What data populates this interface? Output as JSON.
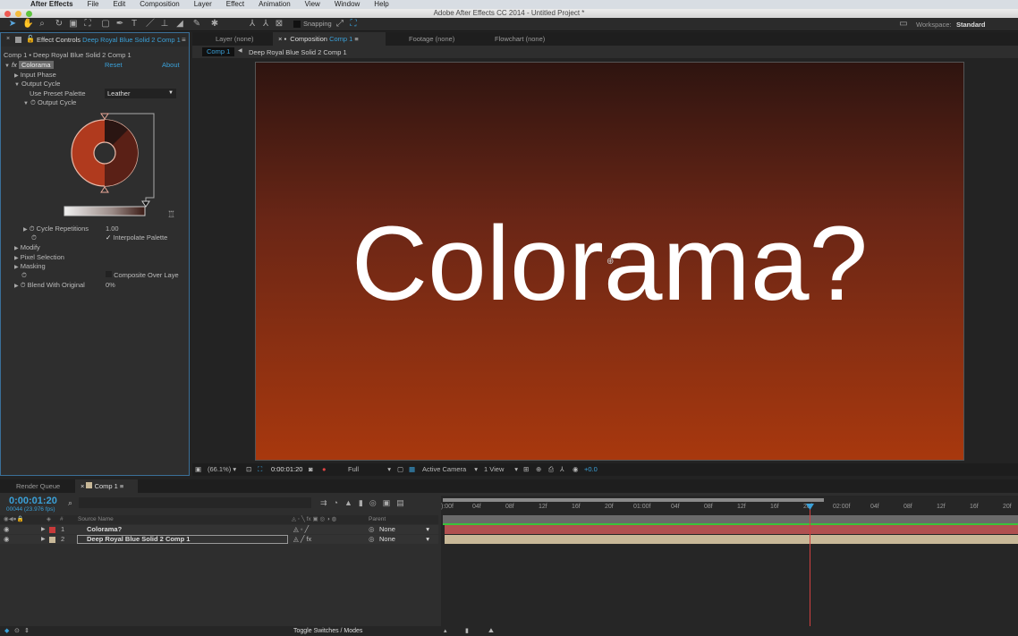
{
  "menubar": {
    "items": [
      "After Effects",
      "File",
      "Edit",
      "Composition",
      "Layer",
      "Effect",
      "Animation",
      "View",
      "Window",
      "Help"
    ]
  },
  "titlebar": {
    "title": "Adobe After Effects CC 2014 - Untitled Project *"
  },
  "toolbar": {
    "snapping_label": "Snapping",
    "workspace_label": "Workspace:",
    "workspace_value": "Standard"
  },
  "effect_controls": {
    "tab_label": "Effect Controls",
    "tab_layer": "Deep Royal Blue Solid 2 Comp 1",
    "breadcrumb": "Comp 1 • Deep Royal Blue Solid 2 Comp 1",
    "effect_name": "Colorama",
    "reset": "Reset",
    "about": "About",
    "props": {
      "input_phase": "Input Phase",
      "output_cycle": "Output Cycle",
      "use_preset_palette": "Use Preset Palette",
      "preset_value": "Leather",
      "output_cycle_sub": "Output Cycle",
      "cycle_repetitions": "Cycle Repetitions",
      "cycle_repetitions_value": "1.00",
      "interpolate_palette": "Interpolate Palette",
      "modify": "Modify",
      "pixel_selection": "Pixel Selection",
      "masking": "Masking",
      "composite_over_layer": "Composite Over Laye",
      "blend_with_original": "Blend With Original",
      "blend_value": "0%"
    }
  },
  "viewer": {
    "tabs": [
      "Layer (none)",
      "Composition",
      "Footage (none)",
      "Flowchart (none)"
    ],
    "comp_tab_name": "Comp 1",
    "breadcrumb_active": "Comp 1",
    "breadcrumb_layer": "Deep Royal Blue Solid 2 Comp 1",
    "canvas_text": "Colorama?",
    "footer": {
      "zoom": "(66.1%)",
      "timecode": "0:00:01:20",
      "resolution": "Full",
      "camera": "Active Camera",
      "views": "1 View",
      "exposure": "+0.0"
    }
  },
  "timeline": {
    "tabs": [
      "Render Queue",
      "Comp 1"
    ],
    "current_time": "0:00:01:20",
    "frame_info": "00044 (23.976 fps)",
    "columns": {
      "num": "#",
      "source_name": "Source Name",
      "parent": "Parent"
    },
    "layers": [
      {
        "num": "1",
        "name": "Colorama?",
        "parent": "None",
        "color": "#c83a3a"
      },
      {
        "num": "2",
        "name": "Deep Royal Blue Solid 2 Comp 1",
        "parent": "None",
        "color": "#c8b898"
      }
    ],
    "ruler": [
      "):00f",
      "04f",
      "08f",
      "12f",
      "16f",
      "20f",
      "01:00f",
      "04f",
      "08f",
      "12f",
      "16f",
      "20f",
      "02:00f",
      "04f",
      "08f",
      "12f",
      "16f",
      "20f"
    ],
    "toggle_label": "Toggle Switches / Modes"
  }
}
